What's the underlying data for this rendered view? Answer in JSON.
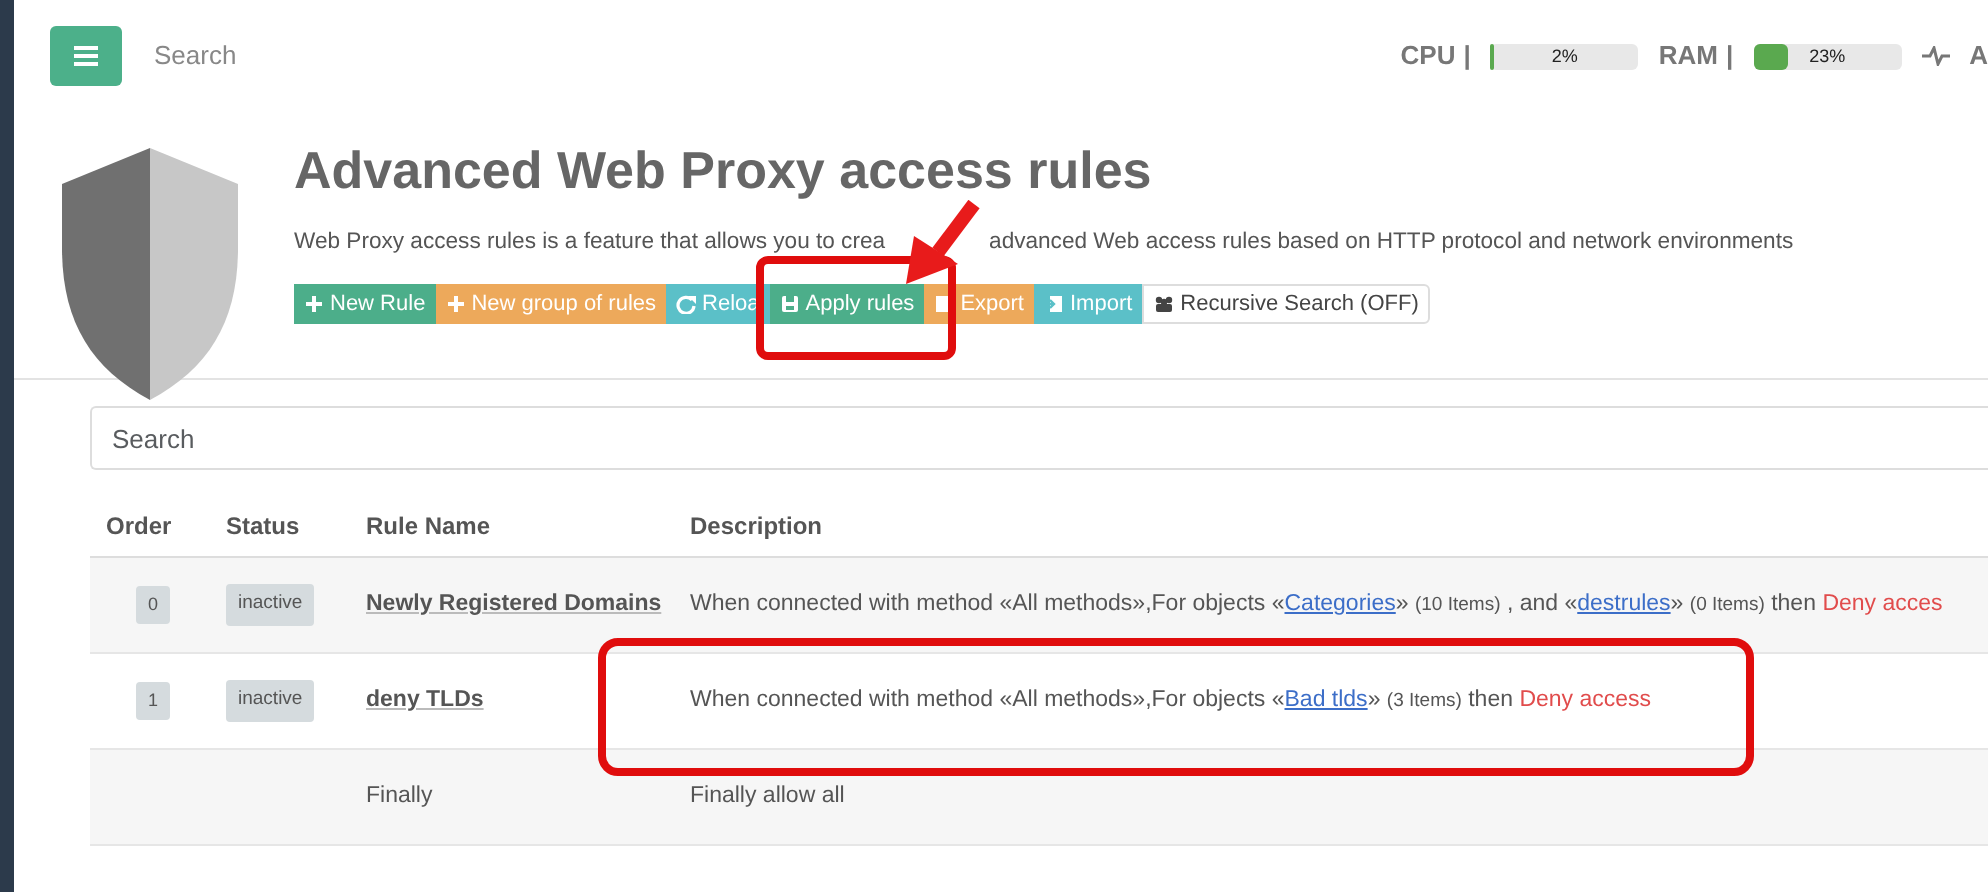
{
  "header": {
    "search_placeholder": "Search",
    "meters": [
      {
        "label": "CPU",
        "separator": "|",
        "reading": "2%",
        "level": 0.02
      },
      {
        "label": "RAM",
        "separator": "|",
        "reading": "23%",
        "level": 0.23
      }
    ],
    "cut_label": "A"
  },
  "page": {
    "title": "Advanced Web Proxy access rules",
    "description": [
      "Web Proxy access rules is a feature that allows you to crea",
      "advanced Web access rules based on HTTP protocol and network environments"
    ]
  },
  "toolbar": [
    {
      "kind": "new",
      "label": "New Rule",
      "highlighted": false
    },
    {
      "kind": "group",
      "label": "New group of rules",
      "highlighted": false
    },
    {
      "kind": "reload",
      "label": "Reloa",
      "highlighted": false
    },
    {
      "kind": "apply",
      "label": "Apply rules",
      "highlighted": true
    },
    {
      "kind": "export",
      "label": "Export",
      "highlighted": false
    },
    {
      "kind": "import",
      "label": "Import",
      "highlighted": false
    },
    {
      "kind": "recursive",
      "label": "Recursive Search (OFF)",
      "highlighted": false
    }
  ],
  "search": {
    "placeholder": "Search"
  },
  "table": {
    "columns": [
      "Order",
      "Status",
      "Rule Name",
      "Description"
    ],
    "rows": [
      {
        "order": "0",
        "status": "inactive",
        "name": "Newly Registered Domains",
        "highlighted": false,
        "description": [
          {
            "kind": "text",
            "text": "When connected with method «All methods»,For objects «"
          },
          {
            "kind": "link",
            "text": "Categories"
          },
          {
            "kind": "text",
            "text": "»"
          },
          {
            "kind": "count",
            "text": "(10 Items)"
          },
          {
            "kind": "text",
            "text": ", and «"
          },
          {
            "kind": "link",
            "text": "destrules"
          },
          {
            "kind": "text",
            "text": "»"
          },
          {
            "kind": "count",
            "text": "(0 Items)"
          },
          {
            "kind": "text",
            "text": "then"
          },
          {
            "kind": "deny",
            "text": "Deny acces"
          }
        ]
      },
      {
        "order": "1",
        "status": "inactive",
        "name": "deny TLDs",
        "highlighted": true,
        "description": [
          {
            "kind": "text",
            "text": "When connected with method «All methods»,For objects «"
          },
          {
            "kind": "link",
            "text": "Bad tlds"
          },
          {
            "kind": "text",
            "text": "»"
          },
          {
            "kind": "count",
            "text": "(3 Items)"
          },
          {
            "kind": "text",
            "text": "then"
          },
          {
            "kind": "deny",
            "text": "Deny access"
          }
        ]
      }
    ],
    "final": {
      "name": "Finally",
      "description": "Finally allow all"
    }
  }
}
